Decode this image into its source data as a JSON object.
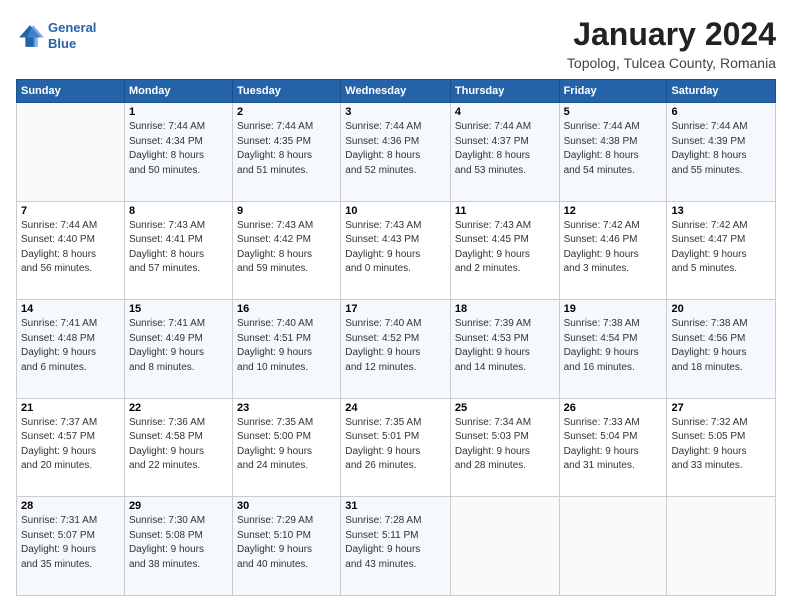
{
  "header": {
    "logo_line1": "General",
    "logo_line2": "Blue",
    "title": "January 2024",
    "subtitle": "Topolog, Tulcea County, Romania"
  },
  "days_of_week": [
    "Sunday",
    "Monday",
    "Tuesday",
    "Wednesday",
    "Thursday",
    "Friday",
    "Saturday"
  ],
  "weeks": [
    [
      {
        "day": "",
        "info": ""
      },
      {
        "day": "1",
        "info": "Sunrise: 7:44 AM\nSunset: 4:34 PM\nDaylight: 8 hours\nand 50 minutes."
      },
      {
        "day": "2",
        "info": "Sunrise: 7:44 AM\nSunset: 4:35 PM\nDaylight: 8 hours\nand 51 minutes."
      },
      {
        "day": "3",
        "info": "Sunrise: 7:44 AM\nSunset: 4:36 PM\nDaylight: 8 hours\nand 52 minutes."
      },
      {
        "day": "4",
        "info": "Sunrise: 7:44 AM\nSunset: 4:37 PM\nDaylight: 8 hours\nand 53 minutes."
      },
      {
        "day": "5",
        "info": "Sunrise: 7:44 AM\nSunset: 4:38 PM\nDaylight: 8 hours\nand 54 minutes."
      },
      {
        "day": "6",
        "info": "Sunrise: 7:44 AM\nSunset: 4:39 PM\nDaylight: 8 hours\nand 55 minutes."
      }
    ],
    [
      {
        "day": "7",
        "info": "Sunrise: 7:44 AM\nSunset: 4:40 PM\nDaylight: 8 hours\nand 56 minutes."
      },
      {
        "day": "8",
        "info": "Sunrise: 7:43 AM\nSunset: 4:41 PM\nDaylight: 8 hours\nand 57 minutes."
      },
      {
        "day": "9",
        "info": "Sunrise: 7:43 AM\nSunset: 4:42 PM\nDaylight: 8 hours\nand 59 minutes."
      },
      {
        "day": "10",
        "info": "Sunrise: 7:43 AM\nSunset: 4:43 PM\nDaylight: 9 hours\nand 0 minutes."
      },
      {
        "day": "11",
        "info": "Sunrise: 7:43 AM\nSunset: 4:45 PM\nDaylight: 9 hours\nand 2 minutes."
      },
      {
        "day": "12",
        "info": "Sunrise: 7:42 AM\nSunset: 4:46 PM\nDaylight: 9 hours\nand 3 minutes."
      },
      {
        "day": "13",
        "info": "Sunrise: 7:42 AM\nSunset: 4:47 PM\nDaylight: 9 hours\nand 5 minutes."
      }
    ],
    [
      {
        "day": "14",
        "info": "Sunrise: 7:41 AM\nSunset: 4:48 PM\nDaylight: 9 hours\nand 6 minutes."
      },
      {
        "day": "15",
        "info": "Sunrise: 7:41 AM\nSunset: 4:49 PM\nDaylight: 9 hours\nand 8 minutes."
      },
      {
        "day": "16",
        "info": "Sunrise: 7:40 AM\nSunset: 4:51 PM\nDaylight: 9 hours\nand 10 minutes."
      },
      {
        "day": "17",
        "info": "Sunrise: 7:40 AM\nSunset: 4:52 PM\nDaylight: 9 hours\nand 12 minutes."
      },
      {
        "day": "18",
        "info": "Sunrise: 7:39 AM\nSunset: 4:53 PM\nDaylight: 9 hours\nand 14 minutes."
      },
      {
        "day": "19",
        "info": "Sunrise: 7:38 AM\nSunset: 4:54 PM\nDaylight: 9 hours\nand 16 minutes."
      },
      {
        "day": "20",
        "info": "Sunrise: 7:38 AM\nSunset: 4:56 PM\nDaylight: 9 hours\nand 18 minutes."
      }
    ],
    [
      {
        "day": "21",
        "info": "Sunrise: 7:37 AM\nSunset: 4:57 PM\nDaylight: 9 hours\nand 20 minutes."
      },
      {
        "day": "22",
        "info": "Sunrise: 7:36 AM\nSunset: 4:58 PM\nDaylight: 9 hours\nand 22 minutes."
      },
      {
        "day": "23",
        "info": "Sunrise: 7:35 AM\nSunset: 5:00 PM\nDaylight: 9 hours\nand 24 minutes."
      },
      {
        "day": "24",
        "info": "Sunrise: 7:35 AM\nSunset: 5:01 PM\nDaylight: 9 hours\nand 26 minutes."
      },
      {
        "day": "25",
        "info": "Sunrise: 7:34 AM\nSunset: 5:03 PM\nDaylight: 9 hours\nand 28 minutes."
      },
      {
        "day": "26",
        "info": "Sunrise: 7:33 AM\nSunset: 5:04 PM\nDaylight: 9 hours\nand 31 minutes."
      },
      {
        "day": "27",
        "info": "Sunrise: 7:32 AM\nSunset: 5:05 PM\nDaylight: 9 hours\nand 33 minutes."
      }
    ],
    [
      {
        "day": "28",
        "info": "Sunrise: 7:31 AM\nSunset: 5:07 PM\nDaylight: 9 hours\nand 35 minutes."
      },
      {
        "day": "29",
        "info": "Sunrise: 7:30 AM\nSunset: 5:08 PM\nDaylight: 9 hours\nand 38 minutes."
      },
      {
        "day": "30",
        "info": "Sunrise: 7:29 AM\nSunset: 5:10 PM\nDaylight: 9 hours\nand 40 minutes."
      },
      {
        "day": "31",
        "info": "Sunrise: 7:28 AM\nSunset: 5:11 PM\nDaylight: 9 hours\nand 43 minutes."
      },
      {
        "day": "",
        "info": ""
      },
      {
        "day": "",
        "info": ""
      },
      {
        "day": "",
        "info": ""
      }
    ]
  ]
}
